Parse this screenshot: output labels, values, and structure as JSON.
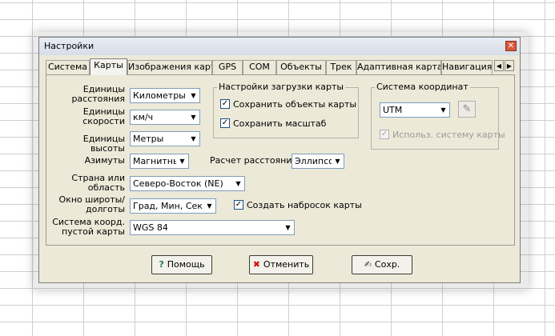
{
  "window": {
    "title": "Настройки"
  },
  "tabs": [
    {
      "label": "Система"
    },
    {
      "label": "Карты"
    },
    {
      "label": "Изображения карт"
    },
    {
      "label": "GPS"
    },
    {
      "label": "COM"
    },
    {
      "label": "Объекты"
    },
    {
      "label": "Трек"
    },
    {
      "label": "Адаптивная карта"
    },
    {
      "label": "Навигация"
    }
  ],
  "form": {
    "distance_units": {
      "label": "Единицы расстояния",
      "value": "Километры"
    },
    "speed_units": {
      "label": "Единицы скорости",
      "value": "км/ч"
    },
    "height_units": {
      "label": "Единицы высоты",
      "value": "Метры"
    },
    "azimuth": {
      "label": "Азимуты",
      "value": "Магнитный"
    },
    "distance_calc": {
      "label": "Расчет расстояний",
      "value": "Эллипсоид"
    },
    "country": {
      "label": "Страна или область",
      "value": "Северо-Восток (NE)"
    },
    "latlon_window": {
      "label": "Окно широты/долготы",
      "value": "Град, Мин, Сек"
    },
    "create_sketch": {
      "label": "Создать набросок карты",
      "checked": true
    },
    "empty_map_coords": {
      "label": "Система коорд. пустой карты",
      "value": "WGS 84"
    }
  },
  "map_load_group": {
    "title": "Настройки загрузки карты",
    "save_objects": {
      "label": "Сохранить объекты карты",
      "checked": true
    },
    "save_scale": {
      "label": "Сохранить масштаб",
      "checked": true
    }
  },
  "coord_group": {
    "title": "Система координат",
    "value": "UTM",
    "use_map_system": {
      "label": "Использ. систему карты",
      "checked": true,
      "disabled": true
    }
  },
  "buttons": {
    "help": "Помощь",
    "cancel": "Отменить",
    "save": "Сохр."
  }
}
